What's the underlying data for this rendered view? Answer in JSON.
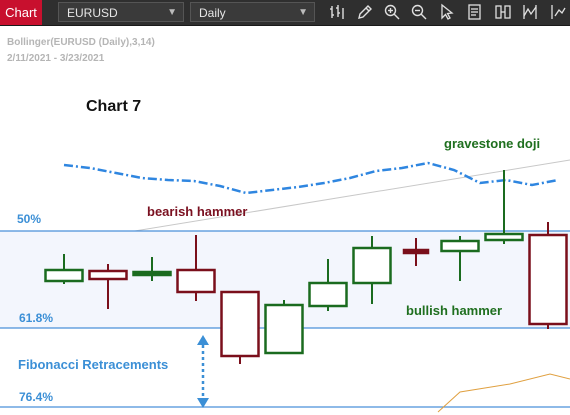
{
  "toolbar": {
    "tab_label": "Chart",
    "symbol_value": "EURUSD",
    "timeframe_value": "Daily",
    "tools": [
      "bars-icon",
      "pencil-icon",
      "zoom-in-icon",
      "zoom-out-icon",
      "cursor-icon",
      "report-icon",
      "compare-icon",
      "indicator-icon"
    ]
  },
  "legend": {
    "study": "Bollinger(EURUSD (Daily),3,14)",
    "date_range": "2/11/2021 - 3/23/2021"
  },
  "annotations": {
    "chart_title": "Chart 7",
    "gravestone": "gravestone doji",
    "bearish_hammer": "bearish hammer",
    "bullish_hammer": "bullish hammer",
    "fibonacci": "Fibonacci Retracements",
    "fib_50": "50%",
    "fib_618": "61.8%",
    "fib_764": "76.4%"
  },
  "colors": {
    "bull": "#1a6b1f",
    "bear": "#7a0f1b",
    "fib_line": "#4a90d9",
    "band": "#2f86e0",
    "fib_label": "#3b8fd6",
    "gravestone_text": "#1f6f1f",
    "bearish_text": "#7a1020"
  },
  "chart_data": {
    "type": "candlestick",
    "candles": [
      {
        "dir": "bull",
        "open": 281,
        "close": 270,
        "high": 254,
        "low": 284
      },
      {
        "dir": "bear",
        "open": 271,
        "close": 279,
        "high": 264,
        "low": 309
      },
      {
        "dir": "bull",
        "open": 275,
        "close": 272,
        "high": 257,
        "low": 281
      },
      {
        "dir": "bear",
        "open": 270,
        "close": 292,
        "high": 235,
        "low": 301
      },
      {
        "dir": "bear",
        "open": 292,
        "close": 356,
        "high": 292,
        "low": 364
      },
      {
        "dir": "bull",
        "open": 353,
        "close": 305,
        "high": 300,
        "low": 353
      },
      {
        "dir": "bull",
        "open": 306,
        "close": 283,
        "high": 259,
        "low": 311
      },
      {
        "dir": "bull",
        "open": 283,
        "close": 248,
        "high": 236,
        "low": 304
      },
      {
        "dir": "bear",
        "open": 250,
        "close": 252,
        "high": 238,
        "low": 266
      },
      {
        "dir": "bull",
        "open": 251,
        "close": 241,
        "high": 236,
        "low": 281
      },
      {
        "dir": "bull",
        "open": 240,
        "close": 234,
        "high": 170,
        "low": 244
      },
      {
        "dir": "bear",
        "open": 235,
        "close": 324,
        "high": 222,
        "low": 329
      }
    ],
    "band_upper": [
      165,
      168,
      173,
      178,
      180,
      181,
      186,
      193,
      190,
      187,
      183,
      178,
      171,
      168,
      163,
      170,
      183,
      180,
      185,
      180
    ],
    "fib_levels": [
      {
        "label": "50%"
      },
      {
        "label": "61.8%"
      },
      {
        "label": "76.4%"
      }
    ]
  }
}
